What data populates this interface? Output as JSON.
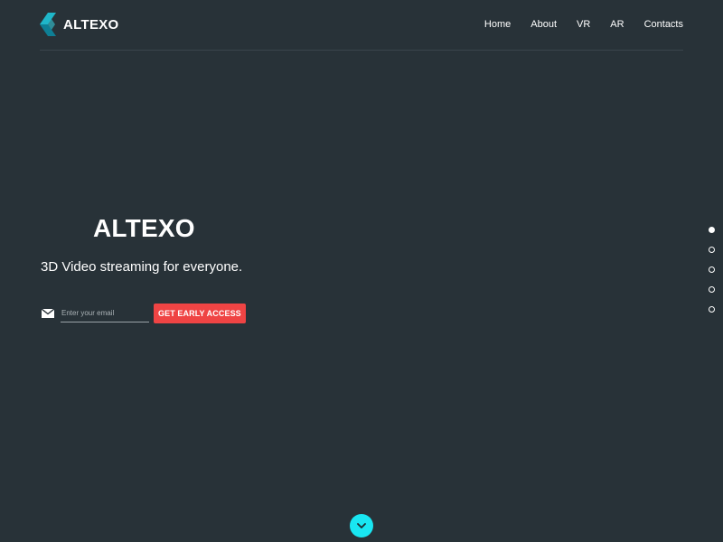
{
  "brand": {
    "name": "ALTEXO",
    "logo_icon": "altexo-logo-icon",
    "logo_colors": [
      "#1fb6c9",
      "#0e7f95"
    ]
  },
  "nav": {
    "items": [
      {
        "label": "Home"
      },
      {
        "label": "About"
      },
      {
        "label": "VR"
      },
      {
        "label": "AR"
      },
      {
        "label": "Contacts"
      }
    ]
  },
  "hero": {
    "title": "ALTEXO",
    "subtitle": "3D Video streaming for everyone."
  },
  "signup": {
    "icon": "mail-icon",
    "email_value": "",
    "email_placeholder": "Enter your email",
    "button_label": "GET EARLY ACCESS",
    "button_color": "#ef4444"
  },
  "pagination": {
    "count": 5,
    "active_index": 0
  },
  "scroll_down": {
    "icon": "chevron-down-icon",
    "color": "#19e6f2"
  },
  "colors": {
    "background": "#283238",
    "text": "#ffffff"
  }
}
